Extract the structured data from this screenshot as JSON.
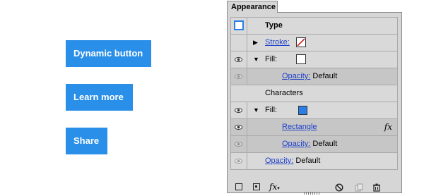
{
  "buttons": {
    "dynamic": "Dynamic button",
    "learn_more": "Learn more",
    "share": "Share"
  },
  "panel": {
    "tab_title": "Appearance",
    "header": {
      "label": "Type"
    },
    "rows": {
      "stroke": "Stroke:",
      "fill1": "Fill:",
      "opacity1_link": "Opacity:",
      "opacity1_value": "Default",
      "characters": "Characters",
      "fill2": "Fill:",
      "rectangle": "Rectangle",
      "opacity2_link": "Opacity:",
      "opacity2_value": "Default",
      "opacity3_link": "Opacity:",
      "opacity3_value": "Default"
    },
    "fx_label": "fx"
  },
  "colors": {
    "button": "#2a8fe8",
    "link": "#1d3fc9",
    "fill_blue": "#2a7ee8",
    "stroke_none": "#d42020"
  },
  "icons": [
    "eye-icon",
    "stroke-none-swatch",
    "fx-icon",
    "new-stroke-icon",
    "new-fill-icon",
    "fx-menu-icon",
    "clear-icon",
    "duplicate-icon",
    "trash-icon",
    "resize-grip-icon"
  ]
}
